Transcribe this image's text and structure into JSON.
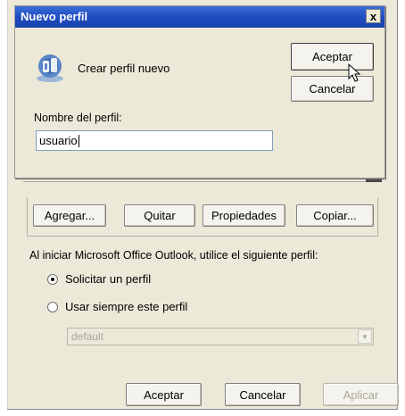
{
  "parent": {
    "buttons": {
      "add": "Agregar...",
      "remove": "Quitar",
      "properties": "Propiedades",
      "copy": "Copiar..."
    },
    "startup_text": "Al iniciar Microsoft Office Outlook, utilice el siguiente perfil:",
    "radio_prompt": {
      "label": "Solicitar un perfil",
      "checked": true
    },
    "radio_always": {
      "label": "Usar siempre este perfil",
      "checked": false
    },
    "profile_select": {
      "value": "default",
      "enabled": false
    },
    "footer": {
      "ok": "Aceptar",
      "cancel": "Cancelar",
      "apply": "Aplicar",
      "apply_enabled": false
    }
  },
  "modal": {
    "title": "Nuevo perfil",
    "close_symbol": "x",
    "heading": "Crear perfil nuevo",
    "ok_label": "Aceptar",
    "cancel_label": "Cancelar",
    "name_label": "Nombre del perfil:",
    "name_value": "usuario",
    "icon": "profile-icon"
  },
  "colors": {
    "title_bar": "#1f4cc0",
    "dialog_bg": "#ece9d8",
    "disabled_text": "#a9a79c"
  }
}
